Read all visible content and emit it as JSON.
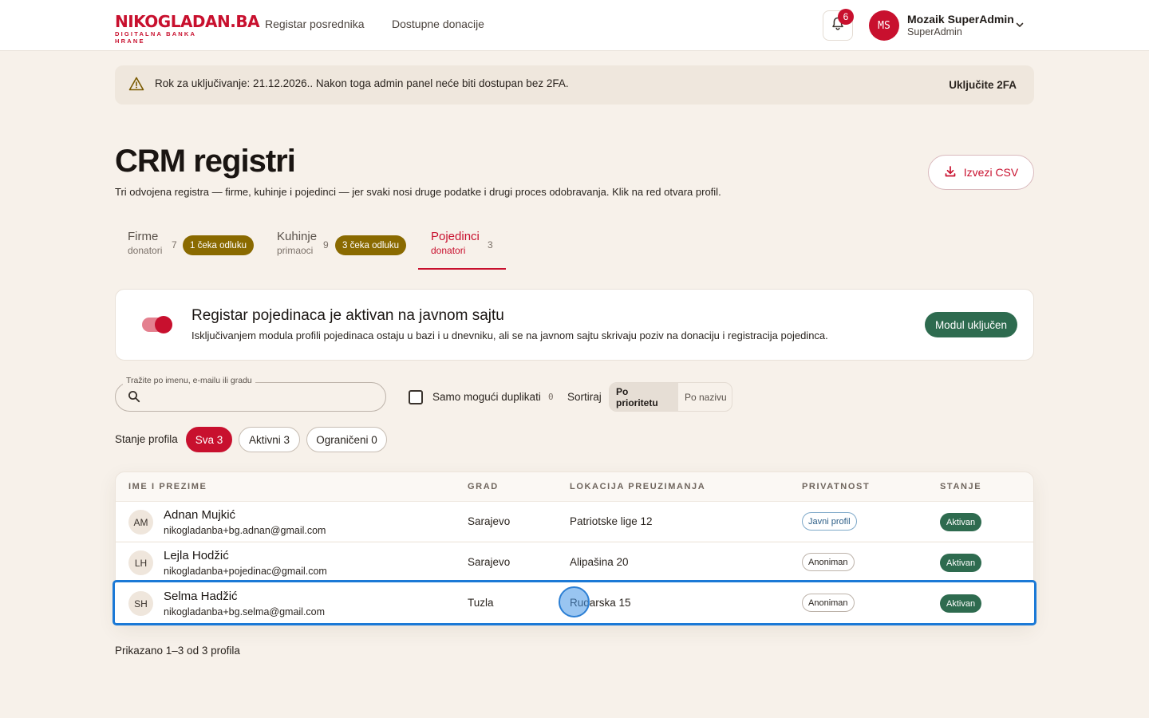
{
  "header": {
    "logo_main": "NIKOGLADAN.BA",
    "logo_sub": "DIGITALNA BANKA HRANE",
    "nav": [
      "Registar posrednika",
      "Dostupne donacije"
    ],
    "notification_count": "6",
    "user_initials": "MS",
    "user_name": "Mozaik SuperAdmin",
    "user_role": "SuperAdmin"
  },
  "alert": {
    "text": "Rok za uključivanje: 21.12.2026.. Nakon toga admin panel neće biti dostupan bez 2FA.",
    "action": "Uključite 2FA"
  },
  "page": {
    "title": "CRM registri",
    "subtitle": "Tri odvojena registra — firme, kuhinje i pojedinci — jer svaki nosi druge podatke i drugi proces odobravanja. Klik na red otvara profil.",
    "export_label": "Izvezi CSV"
  },
  "tabs": [
    {
      "title": "Firme",
      "sub": "donatori",
      "count": "7",
      "badge": "1 čeka odluku"
    },
    {
      "title": "Kuhinje",
      "sub": "primaoci",
      "count": "9",
      "badge": "3 čeka odluku"
    },
    {
      "title": "Pojedinci",
      "sub": "donatori",
      "count": "3",
      "badge": ""
    }
  ],
  "module": {
    "title": "Registar pojedinaca je aktivan na javnom sajtu",
    "description": "Isključivanjem modula profili pojedinaca ostaju u bazi i u dnevniku, ali se na javnom sajtu skrivaju poziv na donaciju i registracija pojedinca.",
    "button": "Modul uključen",
    "enabled": true
  },
  "filters": {
    "search_label": "Tražite po imenu, e-mailu ili gradu",
    "search_value": "",
    "duplicates_label": "Samo mogući duplikati",
    "duplicates_count": "0",
    "sort_label": "Sortiraj",
    "sort_options": [
      "Po prioritetu",
      "Po nazivu"
    ],
    "state_label": "Stanje profila",
    "state_chips": [
      "Sva 3",
      "Aktivni 3",
      "Ograničeni 0"
    ]
  },
  "table": {
    "columns": [
      "IME I PREZIME",
      "GRAD",
      "LOKACIJA PREUZIMANJA",
      "PRIVATNOST",
      "STANJE"
    ],
    "rows": [
      {
        "initials": "AM",
        "name": "Adnan Mujkić",
        "email": "nikogladanba+bg.adnan@gmail.com",
        "city": "Sarajevo",
        "location": "Patriotske lige 12",
        "privacy": "Javni profil",
        "state": "Aktivan"
      },
      {
        "initials": "LH",
        "name": "Lejla Hodžić",
        "email": "nikogladanba+pojedinac@gmail.com",
        "city": "Sarajevo",
        "location": "Alipašina 20",
        "privacy": "Anoniman",
        "state": "Aktivan"
      },
      {
        "initials": "SH",
        "name": "Selma Hadžić",
        "email": "nikogladanba+bg.selma@gmail.com",
        "city": "Tuzla",
        "location": "Rudarska 15",
        "privacy": "Anoniman",
        "state": "Aktivan"
      }
    ]
  },
  "footer": {
    "count_text": "Prikazano 1–3 od 3 profila"
  },
  "colors": {
    "brand": "#c8102e",
    "success": "#2e6b4f",
    "warning_badge": "#8a6a00",
    "background": "#f7f1ea",
    "selection": "#1b79d6"
  },
  "icons": [
    "bell-icon",
    "chevron-down-icon",
    "warning-icon",
    "download-icon",
    "search-icon"
  ]
}
